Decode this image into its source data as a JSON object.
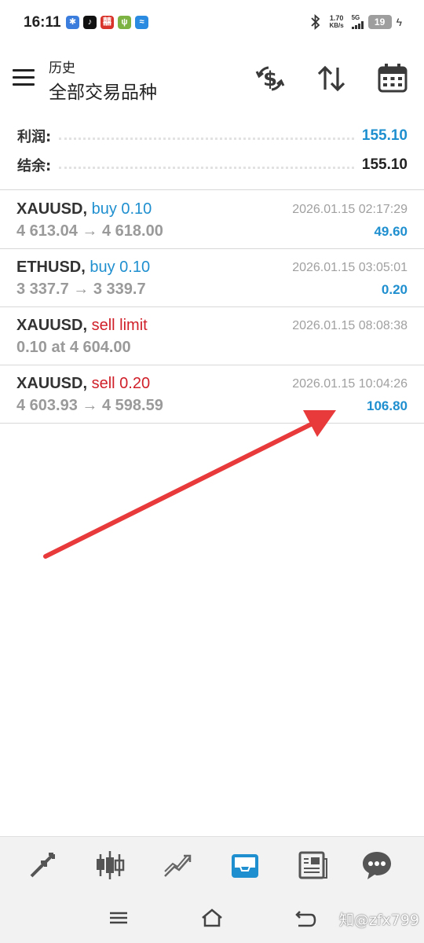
{
  "status_bar": {
    "time": "16:11",
    "apps": [
      {
        "icon": "bluetooth-app-icon",
        "color": "#3b7ddd",
        "glyph": "✱"
      },
      {
        "icon": "tiktok-app-icon",
        "color": "#111111",
        "glyph": "♪"
      },
      {
        "icon": "red-app-icon",
        "color": "#d9342b",
        "glyph": "囍"
      },
      {
        "icon": "usb-app-icon",
        "color": "#7cb342",
        "glyph": "ψ"
      },
      {
        "icon": "blue-app-icon",
        "color": "#2a8be0",
        "glyph": "≈"
      }
    ],
    "speed_value": "1.70",
    "speed_unit": "KB/s",
    "network": "5G",
    "battery": "19"
  },
  "header": {
    "title": "历史",
    "subtitle": "全部交易品种"
  },
  "summary": {
    "profit_label": "利润:",
    "profit_value": "155.10",
    "balance_label": "结余:",
    "balance_value": "155.10"
  },
  "trades": [
    {
      "symbol": "XAUUSD,",
      "direction": "buy 0.10",
      "direction_type": "buy",
      "prices": "4 613.04 → 4 618.00",
      "time": "2026.01.15 02:17:29",
      "profit": "49.60"
    },
    {
      "symbol": "ETHUSD,",
      "direction": "buy 0.10",
      "direction_type": "buy",
      "prices": "3 337.7 → 3 339.7",
      "time": "2026.01.15 03:05:01",
      "profit": "0.20"
    },
    {
      "symbol": "XAUUSD,",
      "direction": "sell limit",
      "direction_type": "sell",
      "prices": "0.10 at 4 604.00",
      "time": "2026.01.15 08:08:38",
      "profit": ""
    },
    {
      "symbol": "XAUUSD,",
      "direction": "sell 0.20",
      "direction_type": "sell",
      "prices": "4 603.93 → 4 598.59",
      "time": "2026.01.15 10:04:26",
      "profit": "106.80"
    }
  ],
  "bottom_nav": [
    {
      "name": "nav-quotes",
      "icon": "quotes-icon",
      "active": false
    },
    {
      "name": "nav-chart",
      "icon": "candlestick-icon",
      "active": false
    },
    {
      "name": "nav-trade",
      "icon": "trade-trend-icon",
      "active": false
    },
    {
      "name": "nav-history",
      "icon": "inbox-history-icon",
      "active": true
    },
    {
      "name": "nav-news",
      "icon": "news-icon",
      "active": false
    },
    {
      "name": "nav-messages",
      "icon": "chat-icon",
      "active": false
    }
  ],
  "watermark": "知@zfx799",
  "colors": {
    "accent_blue": "#1f8fcf",
    "sell_red": "#d0202a",
    "annotation_arrow": "#e8393b"
  }
}
